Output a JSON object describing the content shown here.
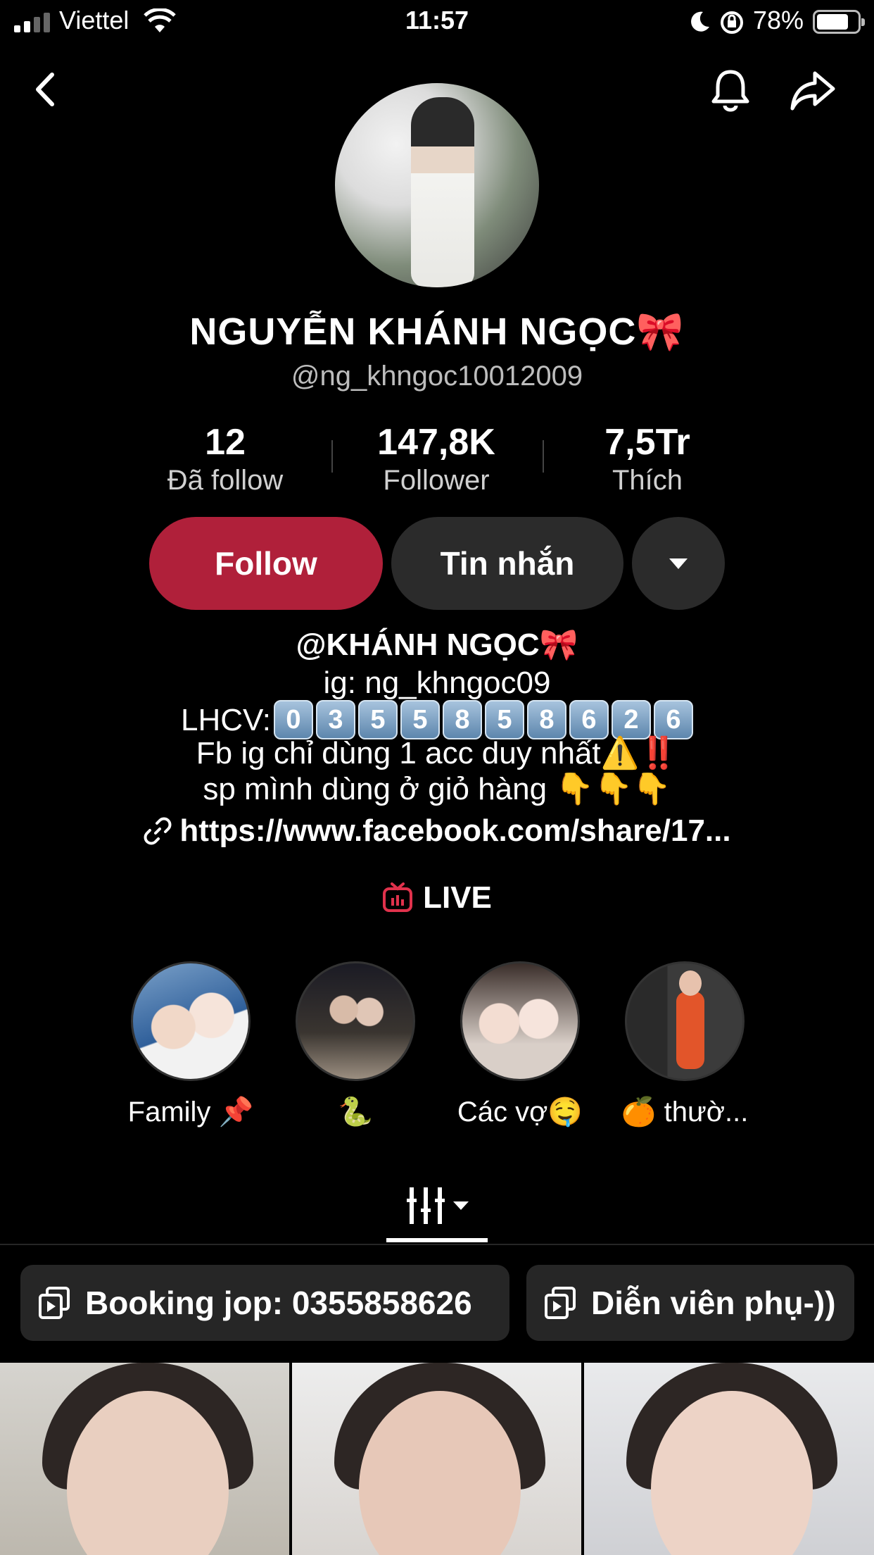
{
  "status_bar": {
    "carrier": "Viettel",
    "time": "11:57",
    "battery": "78%",
    "battery_level": 0.78
  },
  "nav": {
    "back_icon": "chevron-left-icon",
    "bell_icon": "bell-icon",
    "share_icon": "share-arrow-icon"
  },
  "profile": {
    "display_name": "NGUYỄN KHÁNH NGỌC🎀",
    "username": "@ng_khngoc10012009",
    "stats": [
      {
        "value": "12",
        "label": "Đã follow"
      },
      {
        "value": "147,8K",
        "label": "Follower"
      },
      {
        "value": "7,5Tr",
        "label": "Thích"
      }
    ]
  },
  "actions": {
    "follow_label": "Follow",
    "message_label": "Tin nhắn",
    "follow_color": "#b0203a"
  },
  "bio": {
    "title": "@KHÁNH NGỌC🎀",
    "ig": "ig: ng_khngoc09",
    "lhcv_label": "LHCV:",
    "phone_digits": [
      "0",
      "3",
      "5",
      "5",
      "8",
      "5",
      "8",
      "6",
      "2",
      "6"
    ],
    "line_fb": "Fb ig chỉ dùng 1 acc duy nhất⚠️‼️",
    "line_sp": "sp mình dùng ở giỏ hàng 👇👇👇",
    "link": "https://www.facebook.com/share/17..."
  },
  "live": {
    "label": "LIVE",
    "accent": "#e0324c"
  },
  "highlights": [
    {
      "label": "Family 📌"
    },
    {
      "label": "🐍"
    },
    {
      "label": "Các vợ🤤"
    },
    {
      "label": "🍊 thườ..."
    }
  ],
  "playlists": [
    {
      "label": "Booking jop: 0355858626"
    },
    {
      "label": "Diễn viên phụ-))"
    }
  ]
}
